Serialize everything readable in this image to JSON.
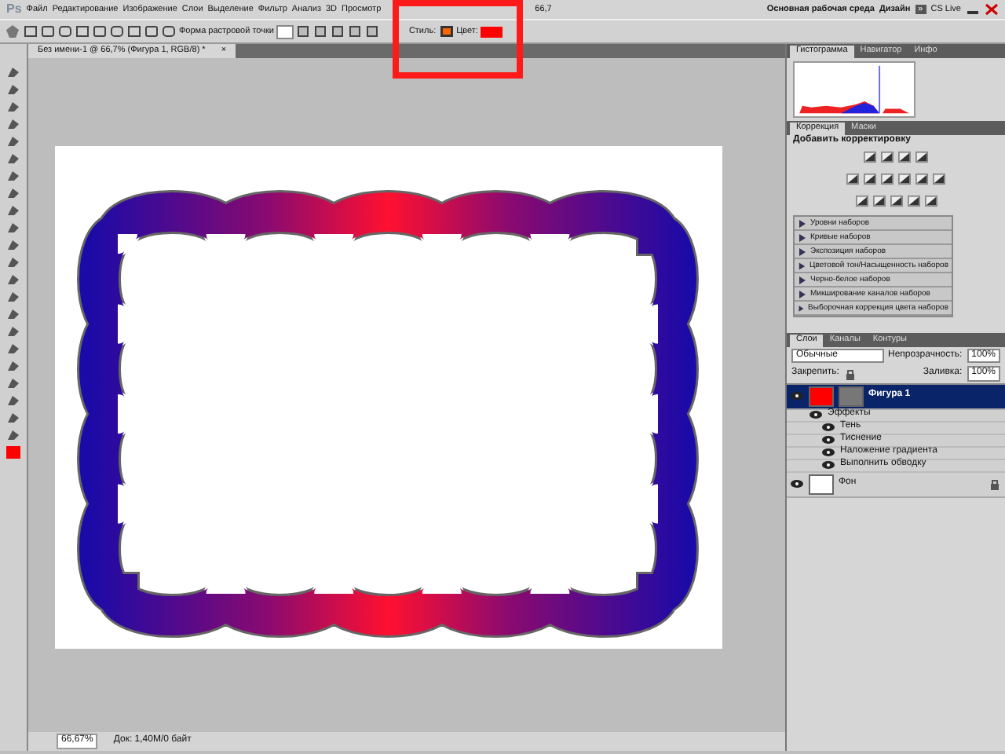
{
  "menu_bar": {
    "logo": "Ps",
    "items": [
      "Файл",
      "Редактирование",
      "Изображение",
      "Слои",
      "Выделение",
      "Фильтр",
      "Анализ",
      "3D",
      "Просмотр"
    ],
    "zoom": "66,7",
    "workspace": "Основная рабочая среда",
    "design": "Дизайн",
    "more": "»",
    "cs_live": "CS Live"
  },
  "options_bar": {
    "shape_label": "Форма растровой точки",
    "style_label": "Стиль:",
    "color_label": "Цвет:"
  },
  "document_tab": {
    "title": "Без имени-1 @ 66,7% (Фигура 1, RGB/8) *",
    "close": "×"
  },
  "status_bar": {
    "zoom": "66,67%",
    "doc_info": "Док: 1,40М/0 байт"
  },
  "histogram_panel": {
    "tabs": [
      {
        "label": "Гистограмма",
        "selected": true
      },
      {
        "label": "Навигатор",
        "selected": false
      },
      {
        "label": "Инфо",
        "selected": false
      }
    ]
  },
  "corrections_panel": {
    "tabs": [
      {
        "label": "Коррекция",
        "selected": true
      },
      {
        "label": "Маски",
        "selected": false
      }
    ],
    "title": "Добавить корректировку",
    "presets": [
      "Уровни наборов",
      "Кривые наборов",
      "Экспозиция наборов",
      "Цветовой тон/Насыщенность наборов",
      "Черно-белое наборов",
      "Микширование каналов наборов",
      "Выборочная коррекция цвета наборов"
    ]
  },
  "layers_panel": {
    "tabs": [
      {
        "label": "Слои",
        "selected": true
      },
      {
        "label": "Каналы",
        "selected": false
      },
      {
        "label": "Контуры",
        "selected": false
      }
    ],
    "blend_mode": "Обычные",
    "opacity_label": "Непрозрачность:",
    "opacity": "100%",
    "lock_label": "Закрепить:",
    "fill_label": "Заливка:",
    "fill": "100%",
    "layers": [
      {
        "name": "Фигура 1",
        "kind": "shape",
        "selected": true,
        "visible": true,
        "children": [
          {
            "name": "Эффекты",
            "visible": true,
            "children": [
              {
                "name": "Тень",
                "visible": true
              },
              {
                "name": "Тиснение",
                "visible": true
              },
              {
                "name": "Наложение градиента",
                "visible": true
              },
              {
                "name": "Выполнить обводку",
                "visible": true
              }
            ]
          }
        ]
      },
      {
        "name": "Фон",
        "kind": "background",
        "selected": false,
        "visible": true
      }
    ]
  }
}
